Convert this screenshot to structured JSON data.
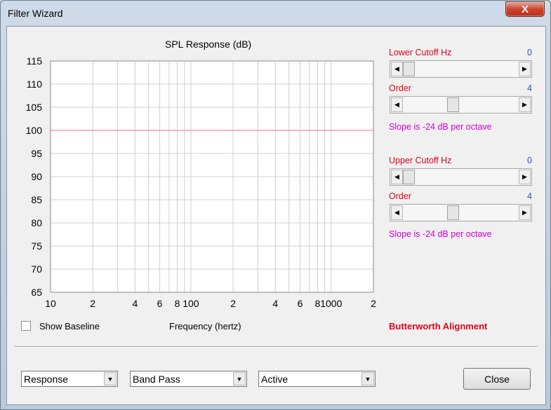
{
  "window": {
    "title": "Filter Wizard",
    "close_glyph": "X"
  },
  "chart_data": {
    "type": "line",
    "title": "SPL Response (dB)",
    "xlabel": "Frequency (hertz)",
    "ylabel": "",
    "xscale": "log",
    "xlim": [
      10,
      2000
    ],
    "ylim": [
      65,
      115
    ],
    "yticks": [
      65,
      70,
      75,
      80,
      85,
      90,
      95,
      100,
      105,
      110,
      115
    ],
    "xtick_labels": [
      {
        "v": 10,
        "t": "10"
      },
      {
        "v": 20,
        "t": "2"
      },
      {
        "v": 40,
        "t": "4"
      },
      {
        "v": 60,
        "t": "6"
      },
      {
        "v": 80,
        "t": "8"
      },
      {
        "v": 100,
        "t": "100"
      },
      {
        "v": 200,
        "t": "2"
      },
      {
        "v": 400,
        "t": "4"
      },
      {
        "v": 600,
        "t": "6"
      },
      {
        "v": 800,
        "t": "8"
      },
      {
        "v": 1000,
        "t": "1000"
      },
      {
        "v": 2000,
        "t": "2"
      }
    ],
    "grid": true,
    "series": [
      {
        "color": "#f4a0a8",
        "x": [
          10,
          2000
        ],
        "y": [
          100,
          100
        ]
      }
    ]
  },
  "right_panel": {
    "lower": {
      "cutoff_label": "Lower Cutoff  Hz",
      "cutoff_value": "0",
      "order_label": "Order",
      "order_value": "4",
      "slope_text": "Slope is -24 dB per octave"
    },
    "upper": {
      "cutoff_label": "Upper Cutoff  Hz",
      "cutoff_value": "0",
      "order_label": "Order",
      "order_value": "4",
      "slope_text": "Slope is -24 dB per octave"
    },
    "alignment": "Butterworth Alignment"
  },
  "controls": {
    "show_baseline_label": "Show Baseline",
    "show_baseline_checked": false,
    "combo_view": "Response",
    "combo_filter": "Band Pass",
    "combo_mode": "Active",
    "close_label": "Close"
  },
  "colors": {
    "grid": "#cfcfcf",
    "plot_border": "#888888",
    "response_line": "#f4a0a8"
  }
}
